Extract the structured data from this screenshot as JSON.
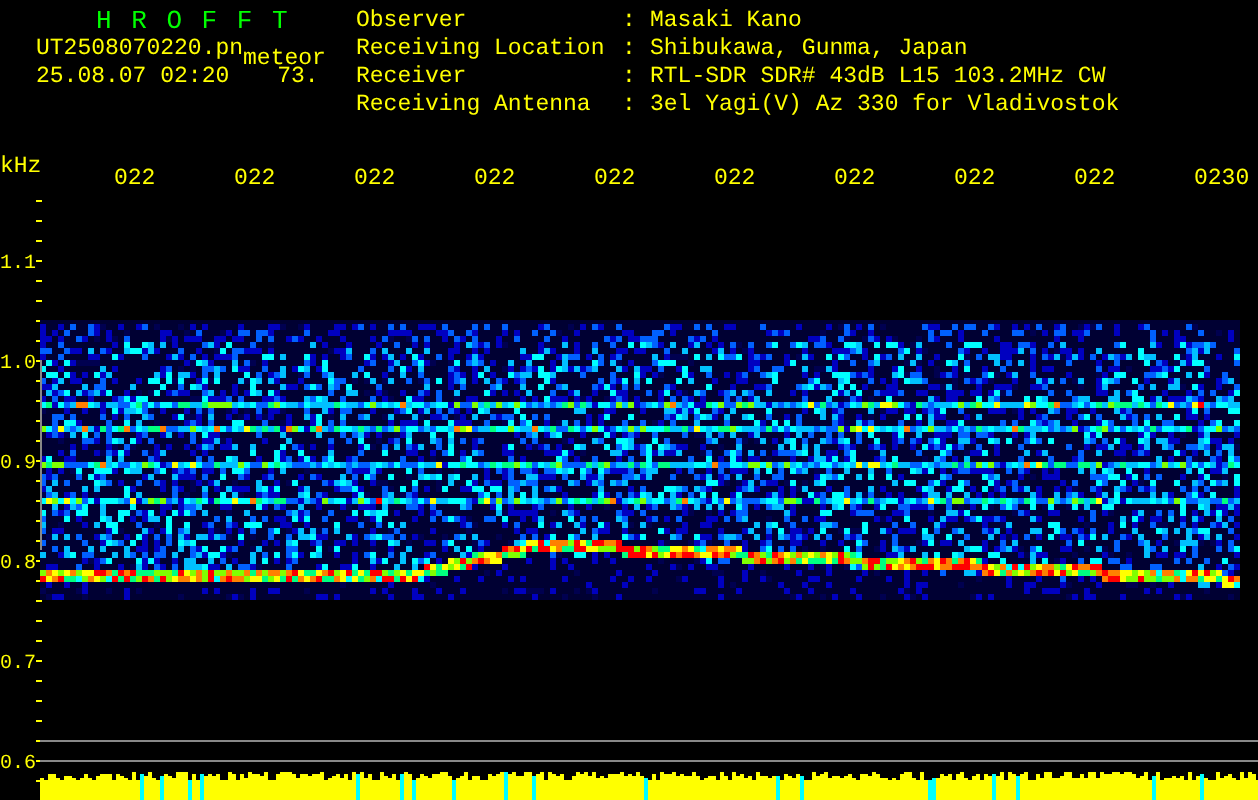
{
  "app_title": "H R O F F T",
  "file_name": "UT2508070220.pn",
  "mode": "meteor",
  "timestamp": "25.08.07 02:20",
  "count": "73.",
  "station": [
    {
      "label": "Observer",
      "separator": ":",
      "value": "Masaki Kano"
    },
    {
      "label": "Receiving Location",
      "separator": ":",
      "value": "Shibukawa, Gunma, Japan"
    },
    {
      "label": "Receiver",
      "separator": ":",
      "value": "RTL-SDR SDR# 43dB L15 103.2MHz CW"
    },
    {
      "label": "Receiving Antenna",
      "separator": ":",
      "value": "3el Yagi(V) Az 330 for Vladivostok"
    }
  ],
  "axis_unit": "kHz",
  "time_labels": [
    "022",
    "022",
    "022",
    "022",
    "022",
    "022",
    "022",
    "022",
    "022",
    "0230"
  ],
  "frequency_labels": [
    "1.1",
    "1.0",
    "0.9",
    "0.8",
    "0.7",
    "0.6"
  ]
}
